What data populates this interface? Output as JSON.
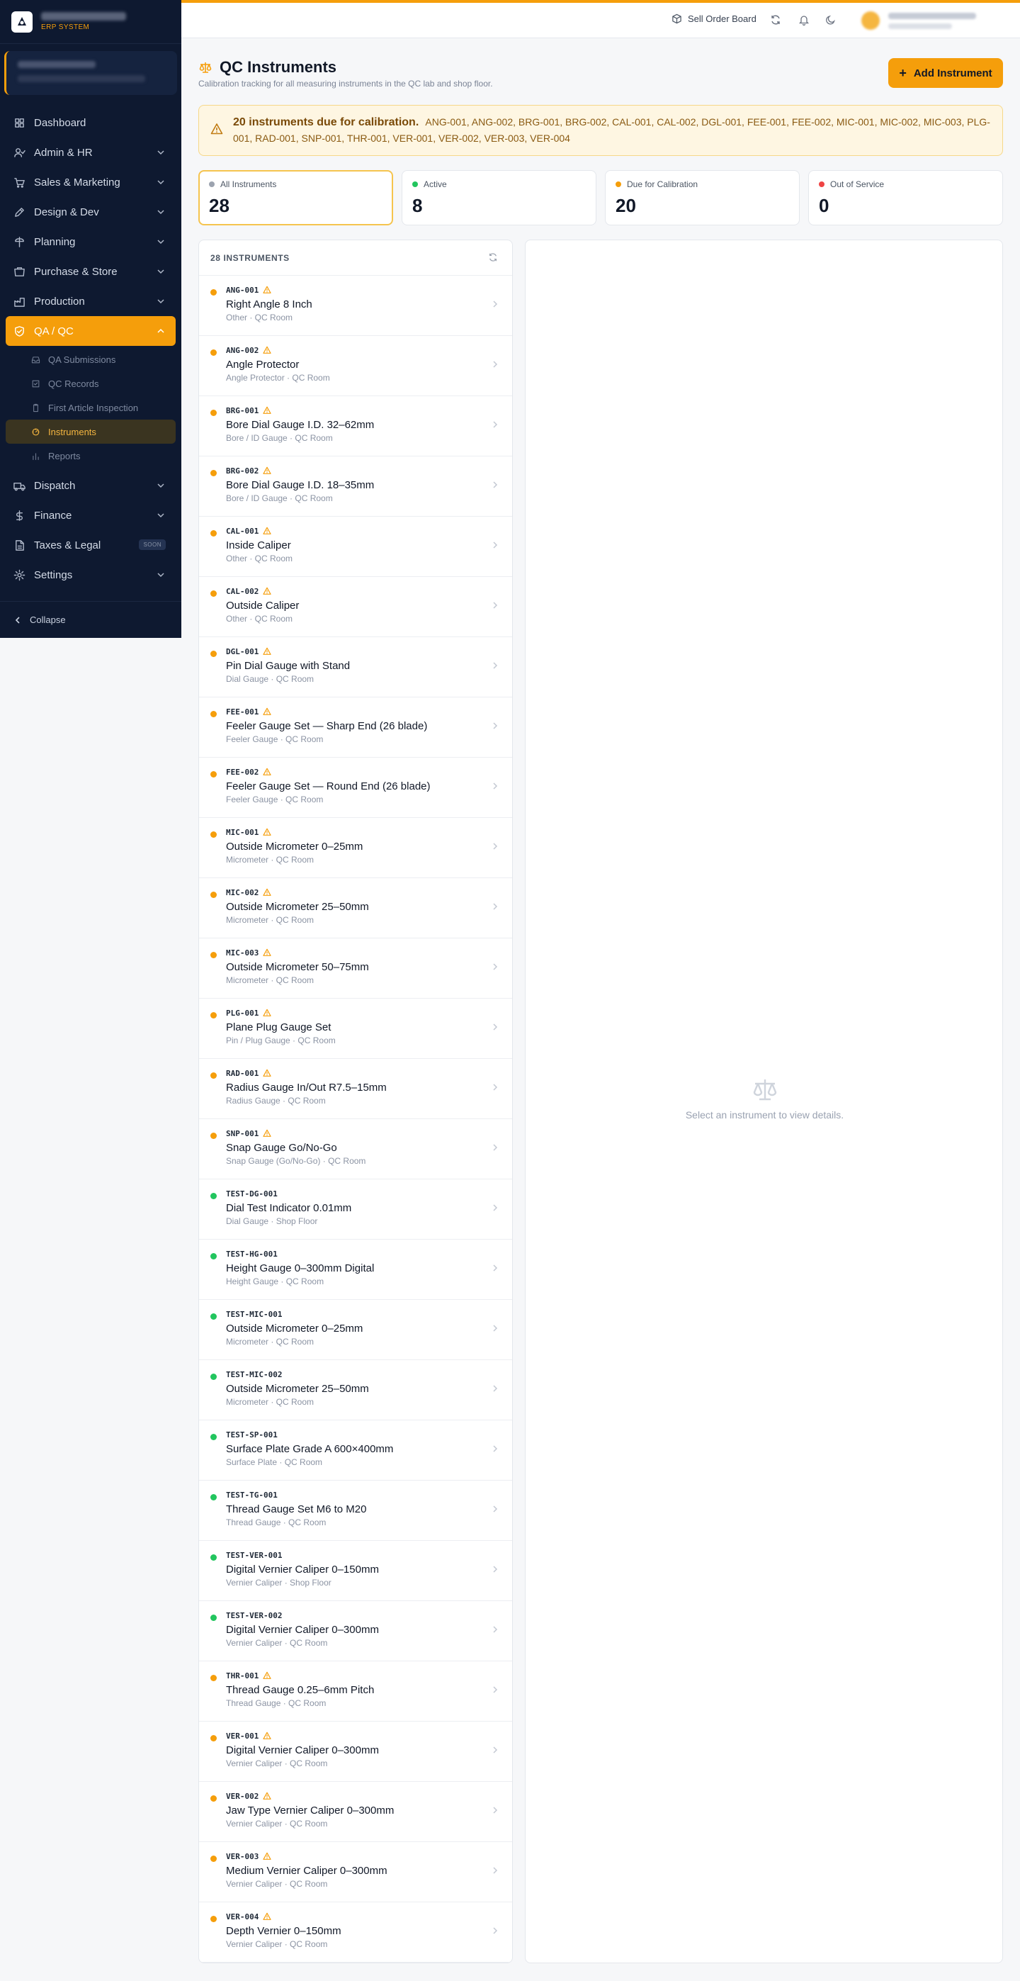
{
  "brand": {
    "subtitle": "ERP SYSTEM"
  },
  "header": {
    "sell_order_board": "Sell Order Board"
  },
  "nav": [
    {
      "label": "Dashboard",
      "icon": "dashboard-icon",
      "chevron": false,
      "active": false
    },
    {
      "label": "Admin & HR",
      "icon": "users-icon",
      "chevron": true,
      "active": false
    },
    {
      "label": "Sales & Marketing",
      "icon": "cart-icon",
      "chevron": true,
      "active": false
    },
    {
      "label": "Design & Dev",
      "icon": "pen-icon",
      "chevron": true,
      "active": false
    },
    {
      "label": "Planning",
      "icon": "planning-icon",
      "chevron": true,
      "active": false
    },
    {
      "label": "Purchase & Store",
      "icon": "store-icon",
      "chevron": true,
      "active": false
    },
    {
      "label": "Production",
      "icon": "factory-icon",
      "chevron": true,
      "active": false
    },
    {
      "label": "QA / QC",
      "icon": "shield-check-icon",
      "chevron": true,
      "active": true
    },
    {
      "label": "Dispatch",
      "icon": "truck-icon",
      "chevron": true,
      "active": false
    },
    {
      "label": "Finance",
      "icon": "dollar-icon",
      "chevron": true,
      "active": false
    },
    {
      "label": "Taxes & Legal",
      "icon": "document-icon",
      "chevron": false,
      "badge": "SOON",
      "active": false
    },
    {
      "label": "Settings",
      "icon": "gear-icon",
      "chevron": true,
      "active": false
    }
  ],
  "subnav": [
    {
      "label": "QA Submissions",
      "icon": "inbox-icon",
      "active": false
    },
    {
      "label": "QC Records",
      "icon": "check-square-icon",
      "active": false
    },
    {
      "label": "First Article Inspection",
      "icon": "clipboard-icon",
      "active": false
    },
    {
      "label": "Instruments",
      "icon": "gauge-icon",
      "active": true
    },
    {
      "label": "Reports",
      "icon": "bar-chart-icon",
      "active": false
    }
  ],
  "collapse_label": "Collapse",
  "page": {
    "title": "QC Instruments",
    "subtitle": "Calibration tracking for all measuring instruments in the QC lab and shop floor.",
    "add_button": "Add Instrument"
  },
  "alert": {
    "title": "20 instruments due for calibration.",
    "body": "ANG-001, ANG-002, BRG-001, BRG-002, CAL-001, CAL-002, DGL-001, FEE-001, FEE-002, MIC-001, MIC-002, MIC-003, PLG-001, RAD-001, SNP-001, THR-001, VER-001, VER-002, VER-003, VER-004"
  },
  "stats": [
    {
      "label": "All Instruments",
      "value": "28",
      "color": "#9ca3af",
      "selected": true
    },
    {
      "label": "Active",
      "value": "8",
      "color": "#22c55e",
      "selected": false
    },
    {
      "label": "Due for Calibration",
      "value": "20",
      "color": "#f59e0b",
      "selected": false
    },
    {
      "label": "Out of Service",
      "value": "0",
      "color": "#ef4444",
      "selected": false
    }
  ],
  "list": {
    "header": "28 INSTRUMENTS",
    "items": [
      {
        "code": "ANG-001",
        "name": "Right Angle 8 Inch",
        "meta": "Other · QC Room",
        "status": "due"
      },
      {
        "code": "ANG-002",
        "name": "Angle Protector",
        "meta": "Angle Protector · QC Room",
        "status": "due"
      },
      {
        "code": "BRG-001",
        "name": "Bore Dial Gauge I.D. 32–62mm",
        "meta": "Bore / ID Gauge · QC Room",
        "status": "due"
      },
      {
        "code": "BRG-002",
        "name": "Bore Dial Gauge I.D. 18–35mm",
        "meta": "Bore / ID Gauge · QC Room",
        "status": "due"
      },
      {
        "code": "CAL-001",
        "name": "Inside Caliper",
        "meta": "Other · QC Room",
        "status": "due"
      },
      {
        "code": "CAL-002",
        "name": "Outside Caliper",
        "meta": "Other · QC Room",
        "status": "due"
      },
      {
        "code": "DGL-001",
        "name": "Pin Dial Gauge with Stand",
        "meta": "Dial Gauge · QC Room",
        "status": "due"
      },
      {
        "code": "FEE-001",
        "name": "Feeler Gauge Set — Sharp End (26 blade)",
        "meta": "Feeler Gauge · QC Room",
        "status": "due"
      },
      {
        "code": "FEE-002",
        "name": "Feeler Gauge Set — Round End (26 blade)",
        "meta": "Feeler Gauge · QC Room",
        "status": "due"
      },
      {
        "code": "MIC-001",
        "name": "Outside Micrometer 0–25mm",
        "meta": "Micrometer · QC Room",
        "status": "due"
      },
      {
        "code": "MIC-002",
        "name": "Outside Micrometer 25–50mm",
        "meta": "Micrometer · QC Room",
        "status": "due"
      },
      {
        "code": "MIC-003",
        "name": "Outside Micrometer 50–75mm",
        "meta": "Micrometer · QC Room",
        "status": "due"
      },
      {
        "code": "PLG-001",
        "name": "Plane Plug Gauge Set",
        "meta": "Pin / Plug Gauge · QC Room",
        "status": "due"
      },
      {
        "code": "RAD-001",
        "name": "Radius Gauge In/Out R7.5–15mm",
        "meta": "Radius Gauge · QC Room",
        "status": "due"
      },
      {
        "code": "SNP-001",
        "name": "Snap Gauge Go/No-Go",
        "meta": "Snap Gauge (Go/No-Go) · QC Room",
        "status": "due"
      },
      {
        "code": "TEST-DG-001",
        "name": "Dial Test Indicator 0.01mm",
        "meta": "Dial Gauge · Shop Floor",
        "status": "active"
      },
      {
        "code": "TEST-HG-001",
        "name": "Height Gauge 0–300mm Digital",
        "meta": "Height Gauge · QC Room",
        "status": "active"
      },
      {
        "code": "TEST-MIC-001",
        "name": "Outside Micrometer 0–25mm",
        "meta": "Micrometer · QC Room",
        "status": "active"
      },
      {
        "code": "TEST-MIC-002",
        "name": "Outside Micrometer 25–50mm",
        "meta": "Micrometer · QC Room",
        "status": "active"
      },
      {
        "code": "TEST-SP-001",
        "name": "Surface Plate Grade A 600×400mm",
        "meta": "Surface Plate · QC Room",
        "status": "active"
      },
      {
        "code": "TEST-TG-001",
        "name": "Thread Gauge Set M6 to M20",
        "meta": "Thread Gauge · QC Room",
        "status": "active"
      },
      {
        "code": "TEST-VER-001",
        "name": "Digital Vernier Caliper 0–150mm",
        "meta": "Vernier Caliper · Shop Floor",
        "status": "active"
      },
      {
        "code": "TEST-VER-002",
        "name": "Digital Vernier Caliper 0–300mm",
        "meta": "Vernier Caliper · QC Room",
        "status": "active"
      },
      {
        "code": "THR-001",
        "name": "Thread Gauge 0.25–6mm Pitch",
        "meta": "Thread Gauge · QC Room",
        "status": "due"
      },
      {
        "code": "VER-001",
        "name": "Digital Vernier Caliper 0–300mm",
        "meta": "Vernier Caliper · QC Room",
        "status": "due"
      },
      {
        "code": "VER-002",
        "name": "Jaw Type Vernier Caliper 0–300mm",
        "meta": "Vernier Caliper · QC Room",
        "status": "due"
      },
      {
        "code": "VER-003",
        "name": "Medium Vernier Caliper 0–300mm",
        "meta": "Vernier Caliper · QC Room",
        "status": "due"
      },
      {
        "code": "VER-004",
        "name": "Depth Vernier 0–150mm",
        "meta": "Vernier Caliper · QC Room",
        "status": "due"
      }
    ]
  },
  "detail": {
    "empty_text": "Select an instrument to view details."
  },
  "colors": {
    "accent": "#f59e0b",
    "due": "#f59e0b",
    "active": "#22c55e",
    "out": "#ef4444",
    "sidebar_bg": "#0e1930"
  }
}
